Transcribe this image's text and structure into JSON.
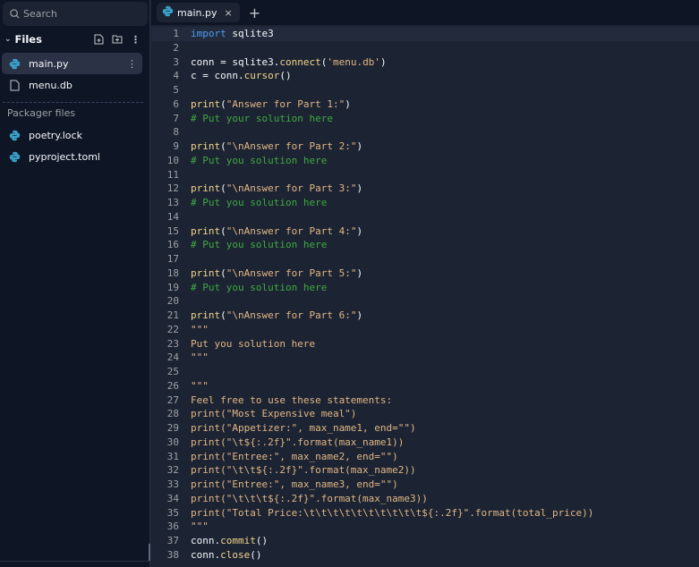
{
  "sidebar": {
    "search_placeholder": "Search",
    "files_label": "Files",
    "files": [
      {
        "name": "main.py",
        "icon": "python-icon",
        "active": true
      },
      {
        "name": "menu.db",
        "icon": "file-icon"
      }
    ],
    "packager_label": "Packager files",
    "packager_files": [
      {
        "name": "poetry.lock",
        "icon": "python-icon"
      },
      {
        "name": "pyproject.toml",
        "icon": "python-icon"
      }
    ]
  },
  "tabs": [
    {
      "label": "main.py",
      "close": "×"
    }
  ],
  "add_tab": "+",
  "colors": {
    "keyword": "#4d9ef0",
    "function": "#f2d68a",
    "string": "#e0b784",
    "comment": "#3faa3f",
    "python_blue": "#3aa0c8"
  },
  "code": [
    [
      [
        "kw",
        "import"
      ],
      [
        "pl",
        " sqlite3"
      ]
    ],
    [],
    [
      [
        "pl",
        "conn = sqlite3."
      ],
      [
        "fn",
        "connect"
      ],
      [
        "pl",
        "("
      ],
      [
        "st",
        "'menu.db'"
      ],
      [
        "pl",
        ")"
      ]
    ],
    [
      [
        "pl",
        "c = conn."
      ],
      [
        "fn",
        "cursor"
      ],
      [
        "pl",
        "()"
      ]
    ],
    [],
    [
      [
        "fn",
        "print"
      ],
      [
        "pl",
        "("
      ],
      [
        "st",
        "\"Answer for Part 1:\""
      ],
      [
        "pl",
        ")"
      ]
    ],
    [
      [
        "cm",
        "# Put your solution here"
      ]
    ],
    [],
    [
      [
        "fn",
        "print"
      ],
      [
        "pl",
        "("
      ],
      [
        "st",
        "\"\\nAnswer for Part 2:\""
      ],
      [
        "pl",
        ")"
      ]
    ],
    [
      [
        "cm",
        "# Put you solution here"
      ]
    ],
    [],
    [
      [
        "fn",
        "print"
      ],
      [
        "pl",
        "("
      ],
      [
        "st",
        "\"\\nAnswer for Part 3:\""
      ],
      [
        "pl",
        ")"
      ]
    ],
    [
      [
        "cm",
        "# Put you solution here"
      ]
    ],
    [],
    [
      [
        "fn",
        "print"
      ],
      [
        "pl",
        "("
      ],
      [
        "st",
        "\"\\nAnswer for Part 4:\""
      ],
      [
        "pl",
        ")"
      ]
    ],
    [
      [
        "cm",
        "# Put you solution here"
      ]
    ],
    [],
    [
      [
        "fn",
        "print"
      ],
      [
        "pl",
        "("
      ],
      [
        "st",
        "\"\\nAnswer for Part 5:\""
      ],
      [
        "pl",
        ")"
      ]
    ],
    [
      [
        "cm",
        "# Put you solution here"
      ]
    ],
    [],
    [
      [
        "fn",
        "print"
      ],
      [
        "pl",
        "("
      ],
      [
        "st",
        "\"\\nAnswer for Part 6:\""
      ],
      [
        "pl",
        ")"
      ]
    ],
    [
      [
        "st",
        "\"\"\""
      ]
    ],
    [
      [
        "st",
        "Put you solution here"
      ]
    ],
    [
      [
        "st",
        "\"\"\""
      ]
    ],
    [],
    [
      [
        "st",
        "\"\"\""
      ]
    ],
    [
      [
        "st",
        "Feel free to use these statements:"
      ]
    ],
    [
      [
        "st",
        "print(\"Most Expensive meal\")"
      ]
    ],
    [
      [
        "st",
        "print(\"Appetizer:\", max_name1, end=\"\")"
      ]
    ],
    [
      [
        "st",
        "print(\"\\t${:.2f}\".format(max_name1))"
      ]
    ],
    [
      [
        "st",
        "print(\"Entree:\", max_name2, end=\"\")"
      ]
    ],
    [
      [
        "st",
        "print(\"\\t\\t${:.2f}\".format(max_name2))"
      ]
    ],
    [
      [
        "st",
        "print(\"Entree:\", max_name3, end=\"\")"
      ]
    ],
    [
      [
        "st",
        "print(\"\\t\\t\\t${:.2f}\".format(max_name3))"
      ]
    ],
    [
      [
        "st",
        "print(\"Total Price:\\t\\t\\t\\t\\t\\t\\t\\t\\t\\t${:.2f}\".format(total_price))"
      ]
    ],
    [
      [
        "st",
        "\"\"\""
      ]
    ],
    [
      [
        "pl",
        "conn."
      ],
      [
        "fn",
        "commit"
      ],
      [
        "pl",
        "()"
      ]
    ],
    [
      [
        "pl",
        "conn."
      ],
      [
        "fn",
        "close"
      ],
      [
        "pl",
        "()"
      ]
    ]
  ]
}
